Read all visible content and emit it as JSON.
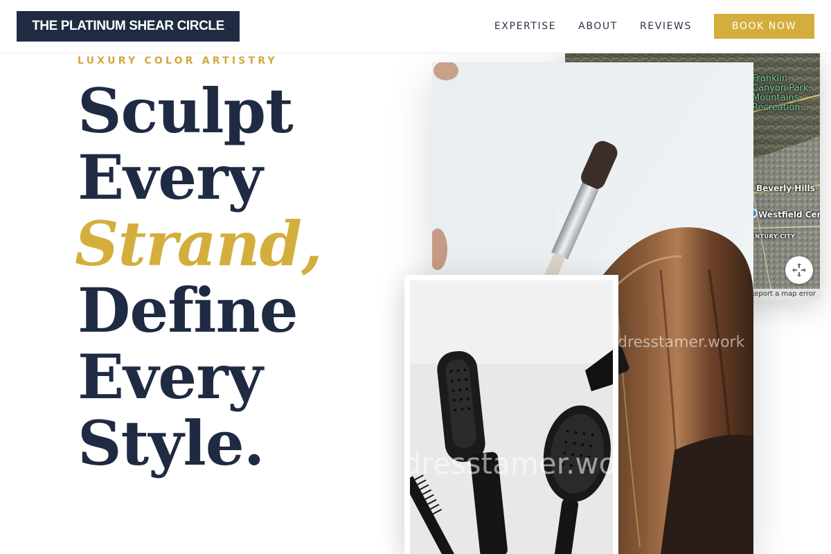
{
  "brand": {
    "name": "THE PLATINUM SHEAR CIRCLE"
  },
  "nav": {
    "items": [
      "EXPERTISE",
      "ABOUT",
      "REVIEWS"
    ],
    "cta": "BOOK NOW"
  },
  "hero": {
    "kicker": "LUXURY COLOR ARTISTRY",
    "lines": [
      "Sculpt",
      "Every",
      "Strand,",
      "Define",
      "Every",
      "Style."
    ]
  },
  "map": {
    "labels": {
      "park": "Franklin\nCanyon Park,\nMountains\nRecreation...",
      "beverly": "Beverly Hills",
      "westfield": "Westfield Cent",
      "city": "CENTURY CITY"
    },
    "report": "Report a map error"
  },
  "watermark": {
    "text": "dresstamer.work"
  },
  "colors": {
    "navy": "#1f2b42",
    "gold": "#d4ae3c",
    "white": "#ffffff"
  },
  "icons": {
    "fullscreen": "fullscreen-icon"
  }
}
